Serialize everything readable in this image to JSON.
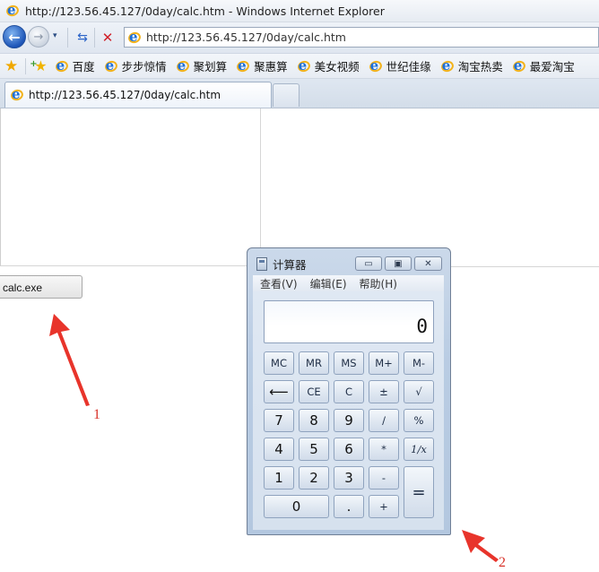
{
  "window": {
    "title": "http://123.56.45.127/0day/calc.htm - Windows Internet Explorer"
  },
  "navbar": {
    "back_glyph": "←",
    "forward_glyph": "→",
    "dropdown_glyph": "▾",
    "refresh_glyph": "⇆",
    "stop_glyph": "✕",
    "address": "http://123.56.45.127/0day/calc.htm"
  },
  "favorites": {
    "items": [
      "百度",
      "步步惊情",
      "聚划算",
      "聚惠算",
      "美女视频",
      "世纪佳缘",
      "淘宝热卖",
      "最爱淘宝"
    ]
  },
  "tabs": [
    {
      "label": "http://123.56.45.127/0day/calc.htm"
    }
  ],
  "page": {
    "button_label": "calc.exe"
  },
  "annotations": {
    "label_1": "1",
    "label_2": "2"
  },
  "calculator": {
    "title": "计算器",
    "window_buttons": {
      "minimize": "▭",
      "maximize": "▣",
      "close": "✕"
    },
    "menu": [
      "查看(V)",
      "编辑(E)",
      "帮助(H)"
    ],
    "display": "0",
    "memory_row": [
      "MC",
      "MR",
      "MS",
      "M+",
      "M-"
    ],
    "row2": [
      "⟵",
      "CE",
      "C",
      "±",
      "√"
    ],
    "row3": [
      "7",
      "8",
      "9",
      "/",
      "%"
    ],
    "row4": [
      "4",
      "5",
      "6",
      "*",
      "1/x"
    ],
    "row5": [
      "1",
      "2",
      "3",
      "-"
    ],
    "row6": [
      "0",
      ".",
      "+"
    ],
    "equals": "="
  },
  "colors": {
    "annotation": "#d8332a",
    "ie_blue": "#1d6fd8"
  }
}
